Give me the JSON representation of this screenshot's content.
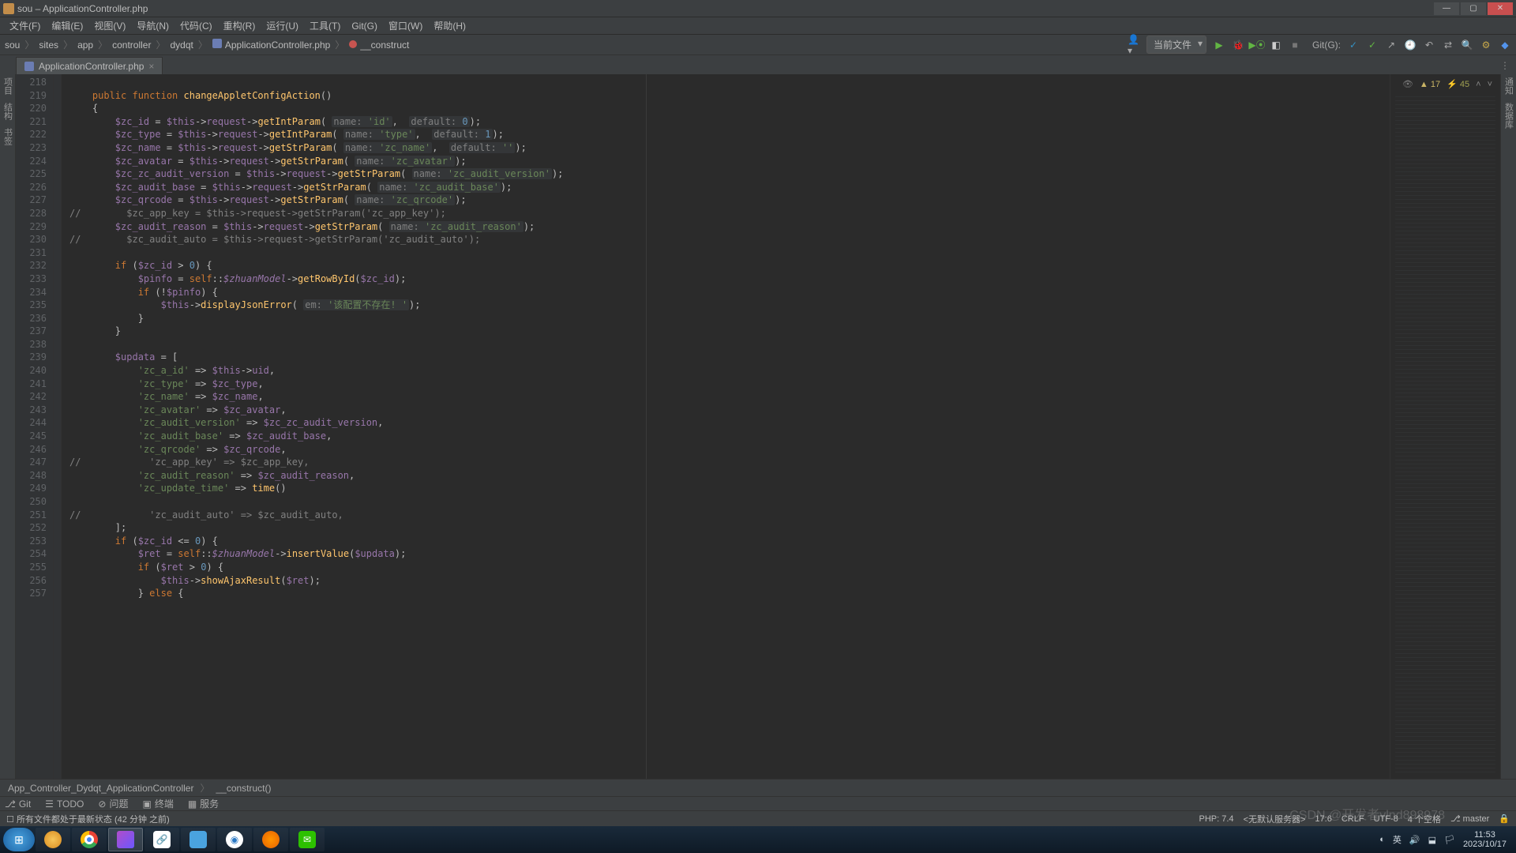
{
  "title": "sou – ApplicationController.php",
  "menus": [
    "文件(F)",
    "编辑(E)",
    "视图(V)",
    "导航(N)",
    "代码(C)",
    "重构(R)",
    "运行(U)",
    "工具(T)",
    "Git(G)",
    "窗口(W)",
    "帮助(H)"
  ],
  "crumbs": [
    "sou",
    "sites",
    "app",
    "controller",
    "dydqt",
    "ApplicationController.php",
    "__construct"
  ],
  "run_config": "当前文件",
  "git_label": "Git(G):",
  "tab_name": "ApplicationController.php",
  "side_labels": [
    "项目",
    "结构",
    "书签"
  ],
  "inspect": {
    "warn": "17",
    "weak": "45"
  },
  "lines_start": 218,
  "lines_end": 257,
  "bottom_crumb_left": "App_Controller_Dydqt_ApplicationController",
  "bottom_crumb_right": "__construct()",
  "toolwins": {
    "git": "Git",
    "todo": "TODO",
    "problems": "问题",
    "terminal": "终端",
    "services": "服务"
  },
  "status_left": "所有文件都处于最新状态 (42 分钟 之前)",
  "status_right": {
    "php": "PHP: 7.4",
    "server": "<无默认服务器>",
    "pos": "17:6",
    "eol": "CRLF",
    "enc": "UTF-8",
    "indent": "4 个空格",
    "branch": "master"
  },
  "tray": {
    "ime": "英",
    "time": "11:53",
    "date": "2023/10/17"
  },
  "watermark": "CSDN @开发者vlnd898978",
  "code": [
    "",
    "    <span class='k-or'>public function</span> <span class='k-yl'>changeAppletConfigAction</span>()",
    "    {",
    "        <span class='k-pu'>$zc_id</span> = <span class='k-pu'>$this</span>-&gt;<span class='k-pu'>request</span>-&gt;<span class='k-yl'>getIntParam</span>( <span class='k-hl'><span class='k-gy'>name:</span> <span class='k-gr'>'id'</span></span>,  <span class='k-hl'><span class='k-gy'>default:</span> <span class='k-bl'>0</span></span>);",
    "        <span class='k-pu'>$zc_type</span> = <span class='k-pu'>$this</span>-&gt;<span class='k-pu'>request</span>-&gt;<span class='k-yl'>getIntParam</span>( <span class='k-hl'><span class='k-gy'>name:</span> <span class='k-gr'>'type'</span></span>,  <span class='k-hl'><span class='k-gy'>default:</span> <span class='k-bl'>1</span></span>);",
    "        <span class='k-pu'>$zc_name</span> = <span class='k-pu'>$this</span>-&gt;<span class='k-pu'>request</span>-&gt;<span class='k-yl'>getStrParam</span>( <span class='k-hl'><span class='k-gy'>name:</span> <span class='k-gr'>'zc_name'</span></span>,  <span class='k-hl'><span class='k-gy'>default:</span> <span class='k-gr'>''</span></span>);",
    "        <span class='k-pu'>$zc_avatar</span> = <span class='k-pu'>$this</span>-&gt;<span class='k-pu'>request</span>-&gt;<span class='k-yl'>getStrParam</span>( <span class='k-hl'><span class='k-gy'>name:</span> <span class='k-gr'>'zc_avatar'</span></span>);",
    "        <span class='k-pu'>$zc_zc_audit_version</span> = <span class='k-pu'>$this</span>-&gt;<span class='k-pu'>request</span>-&gt;<span class='k-yl'>getStrParam</span>( <span class='k-hl'><span class='k-gy'>name:</span> <span class='k-gr'>'zc_audit_version'</span></span>);",
    "        <span class='k-pu'>$zc_audit_base</span> = <span class='k-pu'>$this</span>-&gt;<span class='k-pu'>request</span>-&gt;<span class='k-yl'>getStrParam</span>( <span class='k-hl'><span class='k-gy'>name:</span> <span class='k-gr'>'zc_audit_base'</span></span>);",
    "        <span class='k-pu'>$zc_qrcode</span> = <span class='k-pu'>$this</span>-&gt;<span class='k-pu'>request</span>-&gt;<span class='k-yl'>getStrParam</span>( <span class='k-hl'><span class='k-gy'>name:</span> <span class='k-gr'>'zc_qrcode'</span></span>);",
    "<span class='k-gy'>//        $zc_app_key = $this-&gt;request-&gt;getStrParam('zc_app_key');</span>",
    "        <span class='k-pu'>$zc_audit_reason</span> = <span class='k-pu'>$this</span>-&gt;<span class='k-pu'>request</span>-&gt;<span class='k-yl'>getStrParam</span>( <span class='k-hl'><span class='k-gy'>name:</span> <span class='k-gr'>'zc_audit_reason'</span></span>);",
    "<span class='k-gy'>//        $zc_audit_auto = $this-&gt;request-&gt;getStrParam('zc_audit_auto');</span>",
    "",
    "        <span class='k-or'>if</span> (<span class='k-pu'>$zc_id</span> &gt; <span class='k-bl'>0</span>) {",
    "            <span class='k-pu'>$pinfo</span> = <span class='k-or'>self</span>::<span class='k-pu k-it'>$zhuanModel</span>-&gt;<span class='k-yl'>getRowById</span>(<span class='k-pu'>$zc_id</span>);",
    "            <span class='k-or'>if</span> (!<span class='k-pu'>$pinfo</span>) {",
    "                <span class='k-pu'>$this</span>-&gt;<span class='k-yl'>displayJsonError</span>( <span class='k-hl'><span class='k-gy'>em:</span> <span class='k-gr'>'该配置不存在! '</span></span>);",
    "            }",
    "        }",
    "",
    "        <span class='k-pu'>$updata</span> = [",
    "            <span class='k-gr'>'zc_a_id'</span> =&gt; <span class='k-pu'>$this</span>-&gt;<span class='k-pu'>uid</span>,",
    "            <span class='k-gr'>'zc_type'</span> =&gt; <span class='k-pu'>$zc_type</span>,",
    "            <span class='k-gr'>'zc_name'</span> =&gt; <span class='k-pu'>$zc_name</span>,",
    "            <span class='k-gr'>'zc_avatar'</span> =&gt; <span class='k-pu'>$zc_avatar</span>,",
    "            <span class='k-gr'>'zc_audit_version'</span> =&gt; <span class='k-pu'>$zc_zc_audit_version</span>,",
    "            <span class='k-gr'>'zc_audit_base'</span> =&gt; <span class='k-pu'>$zc_audit_base</span>,",
    "            <span class='k-gr'>'zc_qrcode'</span> =&gt; <span class='k-pu'>$zc_qrcode</span>,",
    "<span class='k-gy'>//            'zc_app_key' =&gt; $zc_app_key,</span>",
    "            <span class='k-gr'>'zc_audit_reason'</span> =&gt; <span class='k-pu'>$zc_audit_reason</span>,",
    "            <span class='k-gr'>'zc_update_time'</span> =&gt; <span class='k-yl'>time</span>()",
    "",
    "<span class='k-gy'>//            'zc_audit_auto' =&gt; $zc_audit_auto,</span>",
    "        ];",
    "        <span class='k-or'>if</span> (<span class='k-pu'>$zc_id</span> &lt;= <span class='k-bl'>0</span>) {",
    "            <span class='k-pu'>$ret</span> = <span class='k-or'>self</span>::<span class='k-pu k-it'>$zhuanModel</span>-&gt;<span class='k-yl'>insertValue</span>(<span class='k-pu'>$updata</span>);",
    "            <span class='k-or'>if</span> (<span class='k-pu'>$ret</span> &gt; <span class='k-bl'>0</span>) {",
    "                <span class='k-pu'>$this</span>-&gt;<span class='k-yl'>showAjaxResult</span>(<span class='k-pu'>$ret</span>);",
    "            } <span class='k-or'>else</span> {"
  ]
}
